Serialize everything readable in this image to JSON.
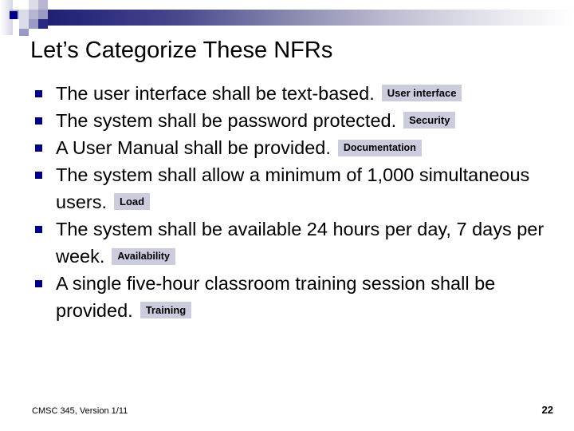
{
  "slide": {
    "title": "Let’s Categorize These NFRs",
    "footer_text": "CMSC 345, Version 1/11",
    "page_number": "22"
  },
  "theme": {
    "bullet_color": "#000080",
    "gradient_start": "#1d1d6e",
    "gradient_end": "#ffffff",
    "tag_background": "#ccccdf",
    "text_color": "#000000",
    "slide_background": "#ffffff"
  },
  "bullets": [
    {
      "text": "The user interface shall be text-based.",
      "tag": "User interface"
    },
    {
      "text": "The system shall be password protected.",
      "tag": "Security"
    },
    {
      "text": "A User Manual shall be provided.",
      "tag": "Documentation"
    },
    {
      "text": "The system shall allow a minimum of 1,000 simultaneous users.",
      "tag": "Load"
    },
    {
      "text": "The system shall be available 24 hours per day, 7 days per week.",
      "tag": "Availability"
    },
    {
      "text": "A single five-hour classroom training session shall be provided.",
      "tag": "Training"
    }
  ]
}
